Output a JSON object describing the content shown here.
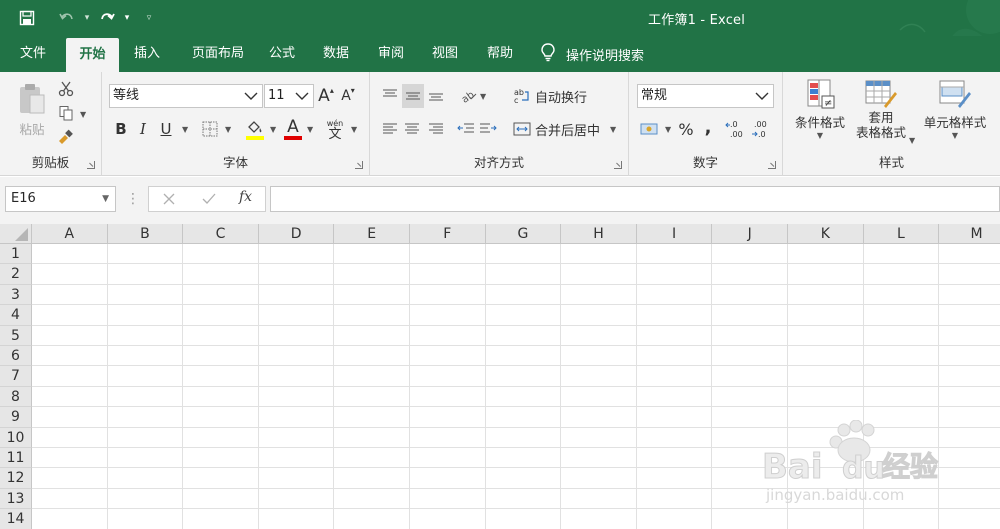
{
  "window": {
    "title": "工作簿1  -  Excel"
  },
  "tabs": [
    {
      "label": "文件"
    },
    {
      "label": "开始"
    },
    {
      "label": "插入"
    },
    {
      "label": "页面布局"
    },
    {
      "label": "公式"
    },
    {
      "label": "数据"
    },
    {
      "label": "审阅"
    },
    {
      "label": "视图"
    },
    {
      "label": "帮助"
    }
  ],
  "tell_me": "操作说明搜索",
  "ribbon": {
    "clipboard": {
      "label": "剪贴板",
      "paste": "粘贴"
    },
    "font": {
      "label": "字体",
      "font_name": "等线",
      "font_size": "11",
      "bold": "B",
      "italic": "I",
      "underline": "U",
      "font_color_letter": "A",
      "grow": "A",
      "shrink": "A",
      "phonetic_top": "wén",
      "phonetic_bottom": "文"
    },
    "alignment": {
      "label": "对齐方式",
      "wrap_text": "自动换行",
      "merge_center": "合并后居中"
    },
    "number": {
      "label": "数字",
      "format": "常规",
      "percent": "%",
      "comma": ","
    },
    "styles": {
      "label": "样式",
      "conditional": "条件格式",
      "table_line1": "套用",
      "table_line2": "表格格式",
      "cell_styles": "单元格样式"
    }
  },
  "formula_bar": {
    "name_box": "E16",
    "fx": "fx",
    "formula": ""
  },
  "columns": [
    "A",
    "B",
    "C",
    "D",
    "E",
    "F",
    "G",
    "H",
    "I",
    "J",
    "K",
    "L",
    "M"
  ],
  "rows": [
    "1",
    "2",
    "3",
    "4",
    "5",
    "6",
    "7",
    "8",
    "9",
    "10",
    "11",
    "12",
    "13",
    "14"
  ],
  "watermark": {
    "brand": "Bai",
    "brand2": "du",
    "cn": "经验",
    "url": "jingyan.baidu.com"
  },
  "colors": {
    "excel_green": "#217346",
    "ribbon_bg": "#f3f3f3",
    "header_bg": "#e6e6e6",
    "gridline": "#e1e1e1"
  }
}
